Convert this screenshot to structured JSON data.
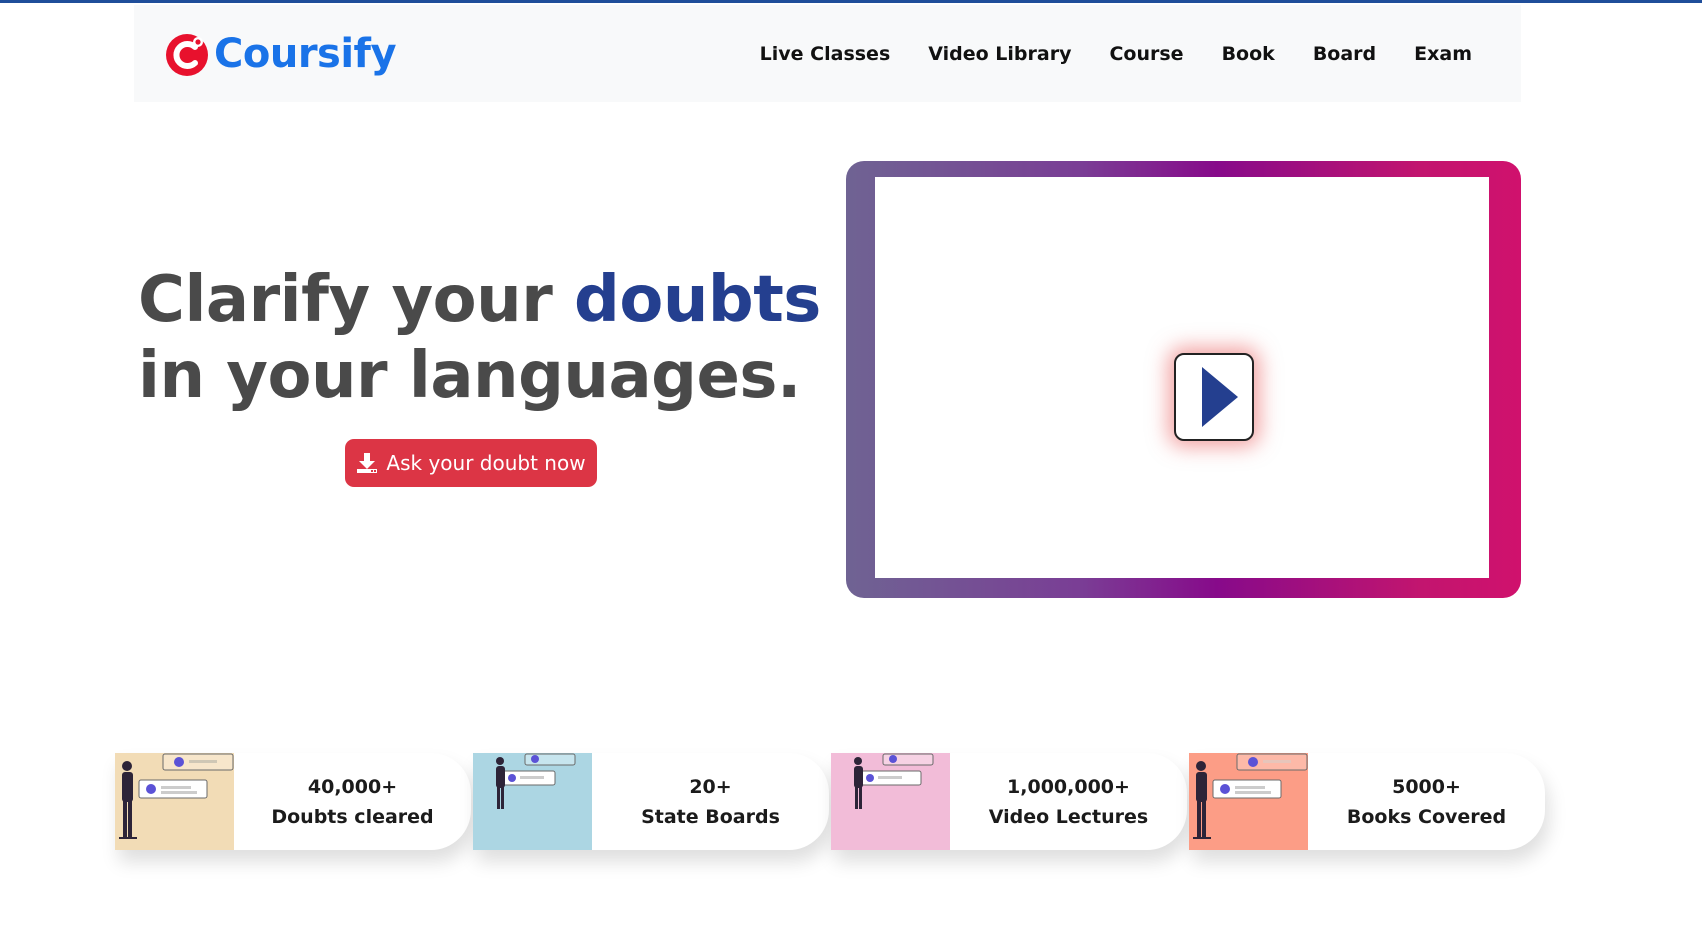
{
  "brand": {
    "name": "Coursify",
    "logo_icon": "coursify-logo-icon",
    "color": "#1a73e8"
  },
  "nav": {
    "items": [
      {
        "label": "Live Classes"
      },
      {
        "label": "Video Library"
      },
      {
        "label": "Course"
      },
      {
        "label": "Book"
      },
      {
        "label": "Board"
      },
      {
        "label": "Exam"
      }
    ]
  },
  "hero": {
    "title_part1": "Clarify your",
    "title_accent": "doubts",
    "title_line2": "in your languages.",
    "cta_label": "Ask your doubt now",
    "cta_icon": "download-icon",
    "accent_color": "#243f8f",
    "cta_color": "#dc3545"
  },
  "video": {
    "play_icon": "play-icon"
  },
  "stats": [
    {
      "value": "40,000+",
      "label": "Doubts cleared",
      "bg": "#f2dcb6"
    },
    {
      "value": "20+",
      "label": "State Boards",
      "bg": "#acd6e3"
    },
    {
      "value": "1,000,000+",
      "label": "Video Lectures",
      "bg": "#f2bcd8"
    },
    {
      "value": "5000+",
      "label": "Books Covered",
      "bg": "#fc9d86"
    }
  ]
}
